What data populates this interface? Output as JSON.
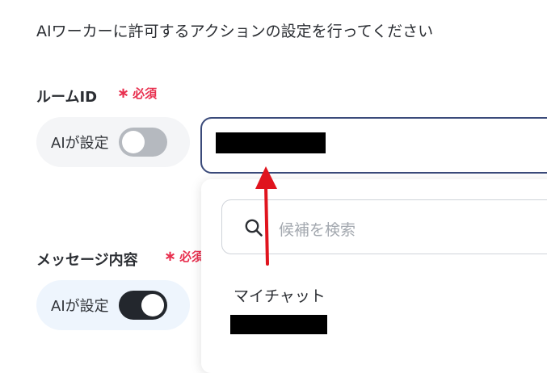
{
  "intro_text": "AIワーカーに許可するアクションの設定を行ってください",
  "room_id": {
    "label": "ルームID",
    "required": "必須",
    "ai_toggle": {
      "label": "AIが設定",
      "on": false
    }
  },
  "message": {
    "label": "メッセージ内容",
    "required": "必須",
    "ai_toggle": {
      "label": "AIが設定",
      "on": true
    }
  },
  "dropdown": {
    "search_placeholder": "候補を検索",
    "options": [
      {
        "title": "マイチャット"
      }
    ]
  },
  "colors": {
    "required": "#e8304f",
    "arrow": "#e0141e",
    "focus_border": "#3a4a7a"
  }
}
